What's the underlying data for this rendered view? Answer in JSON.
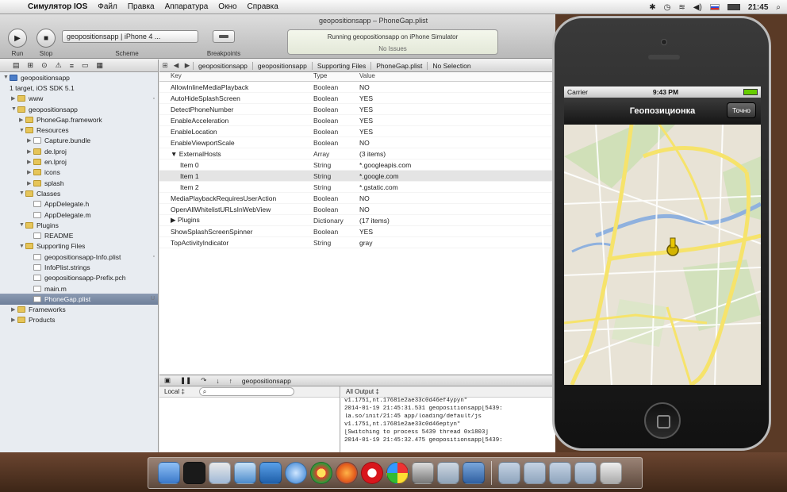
{
  "menubar": {
    "app": "Симулятор IOS",
    "items": [
      "Файл",
      "Правка",
      "Аппаратура",
      "Окно",
      "Справка"
    ],
    "clock": "21:45"
  },
  "toolbar": {
    "run_label": "Run",
    "stop_label": "Stop",
    "scheme_label": "Scheme",
    "scheme_value": "geopositionsapp | iPhone 4 ...",
    "breakpoints_label": "Breakpoints",
    "document_title": "geopositionsapp – PhoneGap.plist",
    "activity_line1": "Running geopositionsapp on iPhone Simulator",
    "activity_line2": "No Issues"
  },
  "navigator": {
    "items": [
      {
        "label": "geopositionsapp",
        "depth": 0,
        "icon": "proj",
        "disc": "▼",
        "badge": ""
      },
      {
        "label": "1 target, iOS SDK 5.1",
        "depth": 0,
        "icon": "",
        "disc": "",
        "badge": ""
      },
      {
        "label": "www",
        "depth": 1,
        "icon": "folder",
        "disc": "▶",
        "badge": "▫"
      },
      {
        "label": "geopositionsapp",
        "depth": 1,
        "icon": "folder",
        "disc": "▼",
        "badge": ""
      },
      {
        "label": "PhoneGap.framework",
        "depth": 2,
        "icon": "folder",
        "disc": "▶",
        "badge": ""
      },
      {
        "label": "Resources",
        "depth": 2,
        "icon": "folder",
        "disc": "▼",
        "badge": ""
      },
      {
        "label": "Capture.bundle",
        "depth": 3,
        "icon": "file",
        "disc": "▶",
        "badge": ""
      },
      {
        "label": "de.lproj",
        "depth": 3,
        "icon": "folder",
        "disc": "▶",
        "badge": ""
      },
      {
        "label": "en.lproj",
        "depth": 3,
        "icon": "folder",
        "disc": "▶",
        "badge": ""
      },
      {
        "label": "icons",
        "depth": 3,
        "icon": "folder",
        "disc": "▶",
        "badge": ""
      },
      {
        "label": "splash",
        "depth": 3,
        "icon": "folder",
        "disc": "▶",
        "badge": ""
      },
      {
        "label": "Classes",
        "depth": 2,
        "icon": "folder",
        "disc": "▼",
        "badge": ""
      },
      {
        "label": "AppDelegate.h",
        "depth": 3,
        "icon": "file",
        "disc": "",
        "badge": ""
      },
      {
        "label": "AppDelegate.m",
        "depth": 3,
        "icon": "file",
        "disc": "",
        "badge": ""
      },
      {
        "label": "Plugins",
        "depth": 2,
        "icon": "folder",
        "disc": "▼",
        "badge": ""
      },
      {
        "label": "README",
        "depth": 3,
        "icon": "file",
        "disc": "",
        "badge": ""
      },
      {
        "label": "Supporting Files",
        "depth": 2,
        "icon": "folder",
        "disc": "▼",
        "badge": ""
      },
      {
        "label": "geopositionsapp-Info.plist",
        "depth": 3,
        "icon": "file",
        "disc": "",
        "badge": "▫"
      },
      {
        "label": "InfoPlist.strings",
        "depth": 3,
        "icon": "file",
        "disc": "",
        "badge": ""
      },
      {
        "label": "geopositionsapp-Prefix.pch",
        "depth": 3,
        "icon": "file",
        "disc": "",
        "badge": ""
      },
      {
        "label": "main.m",
        "depth": 3,
        "icon": "file",
        "disc": "",
        "badge": ""
      },
      {
        "label": "PhoneGap.plist",
        "depth": 3,
        "icon": "file",
        "disc": "",
        "badge": "U",
        "selected": true
      },
      {
        "label": "Frameworks",
        "depth": 1,
        "icon": "folder",
        "disc": "▶",
        "badge": ""
      },
      {
        "label": "Products",
        "depth": 1,
        "icon": "folder",
        "disc": "▶",
        "badge": ""
      }
    ]
  },
  "jumpbar": {
    "crumbs": [
      "geopositionsapp",
      "geopositionsapp",
      "Supporting Files",
      "PhoneGap.plist",
      "No Selection"
    ]
  },
  "plist": {
    "headers": {
      "key": "Key",
      "type": "Type",
      "value": "Value"
    },
    "rows": [
      {
        "key": "AllowInlineMediaPlayback",
        "type": "Boolean",
        "value": "NO",
        "indent": 0
      },
      {
        "key": "AutoHideSplashScreen",
        "type": "Boolean",
        "value": "YES",
        "indent": 0
      },
      {
        "key": "DetectPhoneNumber",
        "type": "Boolean",
        "value": "YES",
        "indent": 0
      },
      {
        "key": "EnableAcceleration",
        "type": "Boolean",
        "value": "YES",
        "indent": 0
      },
      {
        "key": "EnableLocation",
        "type": "Boolean",
        "value": "YES",
        "indent": 0
      },
      {
        "key": "EnableViewportScale",
        "type": "Boolean",
        "value": "NO",
        "indent": 0
      },
      {
        "key": "▼ ExternalHosts",
        "type": "Array",
        "value": "(3 items)",
        "indent": 0
      },
      {
        "key": "Item 0",
        "type": "String",
        "value": "*.googleapis.com",
        "indent": 1
      },
      {
        "key": "Item 1",
        "type": "String",
        "value": "*.google.com",
        "indent": 1,
        "highlight": true
      },
      {
        "key": "Item 2",
        "type": "String",
        "value": "*.gstatic.com",
        "indent": 1
      },
      {
        "key": "MediaPlaybackRequiresUserAction",
        "type": "Boolean",
        "value": "NO",
        "indent": 0
      },
      {
        "key": "OpenAllWhitelistURLsInWebView",
        "type": "Boolean",
        "value": "NO",
        "indent": 0
      },
      {
        "key": "▶ Plugins",
        "type": "Dictionary",
        "value": "(17 items)",
        "indent": 0
      },
      {
        "key": "ShowSplashScreenSpinner",
        "type": "Boolean",
        "value": "YES",
        "indent": 0
      },
      {
        "key": "TopActivityIndicator",
        "type": "String",
        "value": "gray",
        "indent": 0
      }
    ]
  },
  "debug": {
    "target": "geopositionsapp",
    "locals_label": "Local ‡",
    "search_placeholder": "",
    "console_label": "All Output ‡",
    "console_lines": [
      "v1.1751,nt.17681e2ae33c0d46ef4ypyn\"",
      "2014-01-19 21:45:31.531 geopositionsapp[5439:",
      "la.so/init/21:45 app/loading/default/js",
      "v1.1751,nt.17681e2ae33c0d46eptyn\"",
      "[Switching to process 5439 thread 0x1803]",
      "2014-01-19 21:45:32.475 geopositionsapp[5439:"
    ]
  },
  "phone": {
    "carrier": "Carrier",
    "time": "9:43 PM",
    "title": "Геопозиционка",
    "nav_button": "Точно"
  },
  "colors": {
    "accent": "#4c7ec9",
    "map_bg": "#e8e3d6",
    "road_yellow": "#f6e36b",
    "park_green": "#c9dfb0",
    "river_blue": "#8fb1de",
    "marker": "#d4b400"
  }
}
